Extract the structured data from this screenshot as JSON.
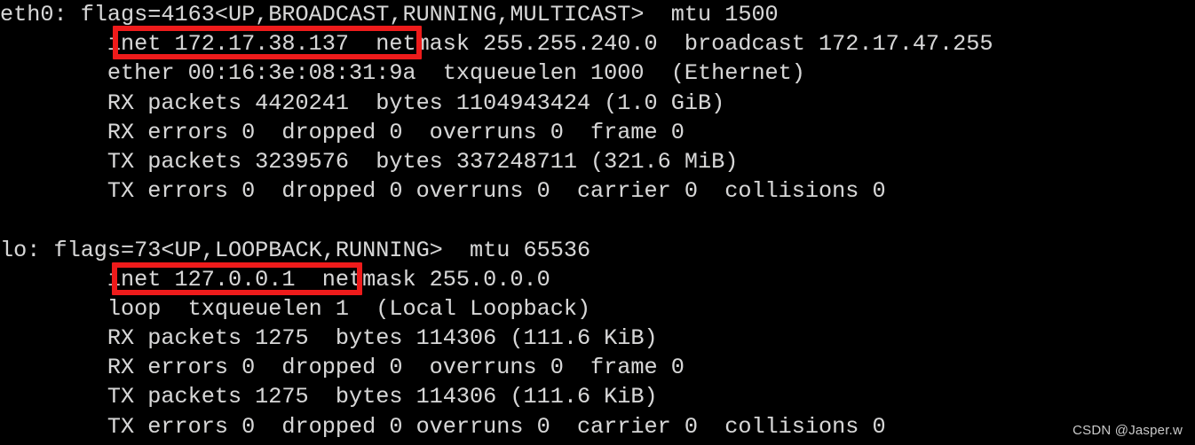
{
  "terminal": {
    "command_output_title": "ifconfig",
    "background_color": "#000000",
    "text_color": "#d6d6d6",
    "highlight_color": "#ee1b1b",
    "lines": [
      "eth0: flags=4163<UP,BROADCAST,RUNNING,MULTICAST>  mtu 1500",
      "        inet 172.17.38.137  netmask 255.255.240.0  broadcast 172.17.47.255",
      "        ether 00:16:3e:08:31:9a  txqueuelen 1000  (Ethernet)",
      "        RX packets 4420241  bytes 1104943424 (1.0 GiB)",
      "        RX errors 0  dropped 0  overruns 0  frame 0",
      "        TX packets 3239576  bytes 337248711 (321.6 MiB)",
      "        TX errors 0  dropped 0 overruns 0  carrier 0  collisions 0",
      "",
      "lo: flags=73<UP,LOOPBACK,RUNNING>  mtu 65536",
      "        inet 127.0.0.1  netmask 255.0.0.0",
      "        loop  txqueuelen 1  (Local Loopback)",
      "        RX packets 1275  bytes 114306 (111.6 KiB)",
      "        RX errors 0  dropped 0  overruns 0  frame 0",
      "        TX packets 1275  bytes 114306 (111.6 KiB)",
      "        TX errors 0  dropped 0 overruns 0  carrier 0  collisions 0"
    ],
    "interfaces": [
      {
        "name": "eth0",
        "flags": "4163<UP,BROADCAST,RUNNING,MULTICAST>",
        "mtu": "1500",
        "inet": "172.17.38.137",
        "netmask": "255.255.240.0",
        "broadcast": "172.17.47.255",
        "ether": "00:16:3e:08:31:9a",
        "txqueuelen": "1000",
        "link_type": "(Ethernet)",
        "rx_packets": "4420241",
        "rx_bytes": "1104943424",
        "rx_bytes_human": "(1.0 GiB)",
        "rx_errors": "0",
        "rx_dropped": "0",
        "rx_overruns": "0",
        "rx_frame": "0",
        "tx_packets": "3239576",
        "tx_bytes": "337248711",
        "tx_bytes_human": "(321.6 MiB)",
        "tx_errors": "0",
        "tx_dropped": "0",
        "tx_overruns": "0",
        "tx_carrier": "0",
        "tx_collisions": "0",
        "highlighted_value": "inet 172.17.38.137"
      },
      {
        "name": "lo",
        "flags": "73<UP,LOOPBACK,RUNNING>",
        "mtu": "65536",
        "inet": "127.0.0.1",
        "netmask": "255.0.0.0",
        "txqueuelen": "1",
        "link_type": "(Local Loopback)",
        "rx_packets": "1275",
        "rx_bytes": "114306",
        "rx_bytes_human": "(111.6 KiB)",
        "rx_errors": "0",
        "rx_dropped": "0",
        "rx_overruns": "0",
        "rx_frame": "0",
        "tx_packets": "1275",
        "tx_bytes": "114306",
        "tx_bytes_human": "(111.6 KiB)",
        "tx_errors": "0",
        "tx_dropped": "0",
        "tx_overruns": "0",
        "tx_carrier": "0",
        "tx_collisions": "0",
        "highlighted_value": "inet 127.0.0.1"
      }
    ]
  },
  "watermark": {
    "text": "CSDN @Jasper.w"
  }
}
